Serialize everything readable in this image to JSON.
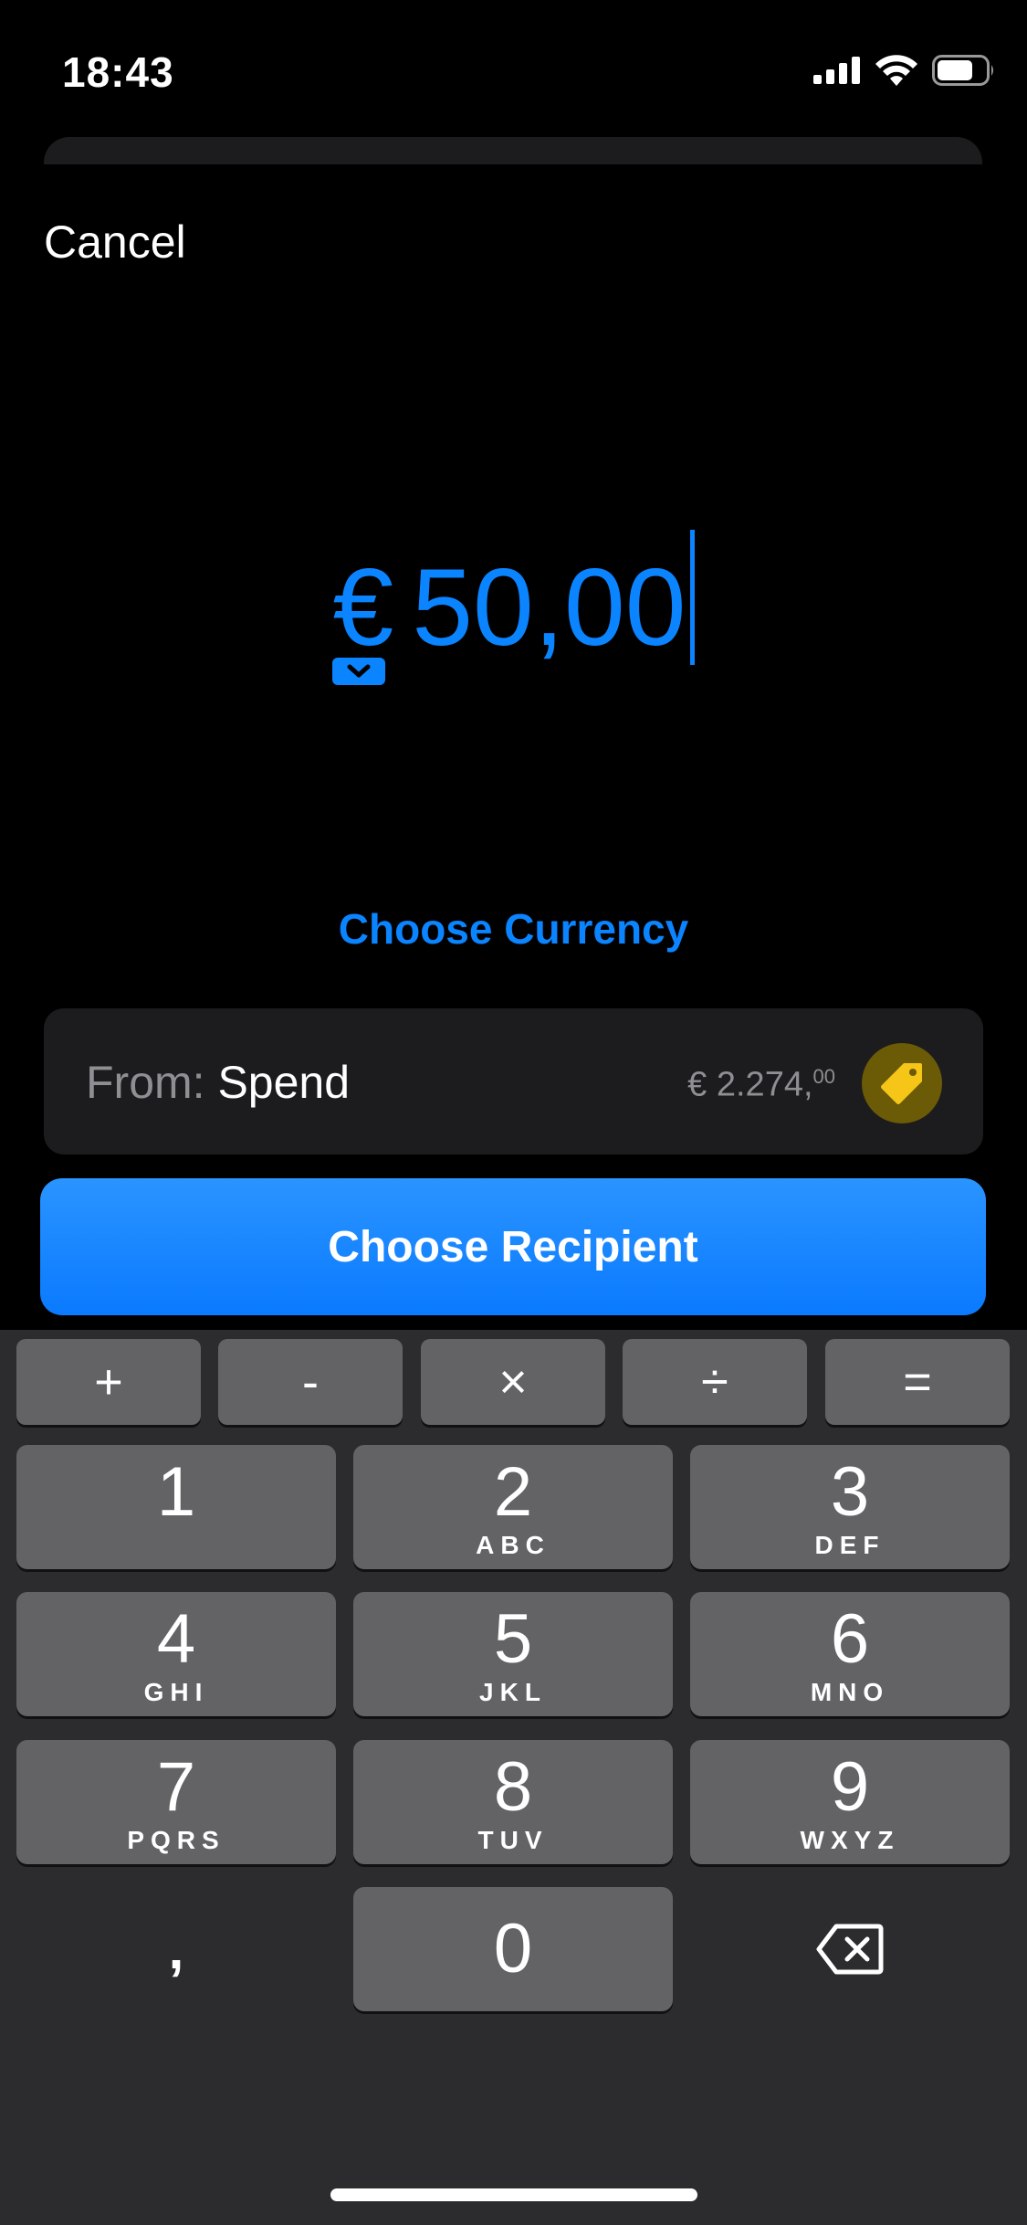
{
  "status_bar": {
    "time": "18:43"
  },
  "header": {
    "cancel_label": "Cancel"
  },
  "amount": {
    "currency_symbol": "€",
    "value": "50,00"
  },
  "choose_currency_label": "Choose Currency",
  "from_card": {
    "label": "From:",
    "account_name": "Spend",
    "balance_main": "€ 2.274,",
    "balance_cents": "00",
    "tag_color": "#f5c518"
  },
  "recipient_button_label": "Choose Recipient",
  "keyboard": {
    "operators": [
      "+",
      "-",
      "×",
      "÷",
      "="
    ],
    "keys": [
      {
        "num": "1",
        "letters": ""
      },
      {
        "num": "2",
        "letters": "ABC"
      },
      {
        "num": "3",
        "letters": "DEF"
      },
      {
        "num": "4",
        "letters": "GHI"
      },
      {
        "num": "5",
        "letters": "JKL"
      },
      {
        "num": "6",
        "letters": "MNO"
      },
      {
        "num": "7",
        "letters": "PQRS"
      },
      {
        "num": "8",
        "letters": "TUV"
      },
      {
        "num": "9",
        "letters": "WXYZ"
      },
      {
        "num": "0",
        "letters": ""
      }
    ],
    "comma_label": ","
  },
  "accent_color": "#0a84ff"
}
